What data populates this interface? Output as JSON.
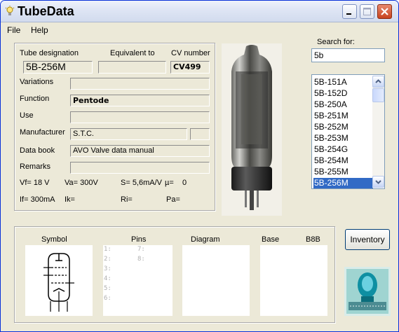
{
  "window": {
    "title": "TubeData"
  },
  "menu": {
    "file": "File",
    "help": "Help"
  },
  "fields": {
    "tube_designation_label": "Tube designation",
    "tube_designation_value": "5B-256M",
    "equivalent_label": "Equivalent to",
    "equivalent_value": "",
    "cv_label": "CV number",
    "cv_value": "CV499",
    "variations_label": "Variations",
    "variations_value": "",
    "function_label": "Function",
    "function_value": "Pentode",
    "use_label": "Use",
    "use_value": "",
    "manufacturer_label": "Manufacturer",
    "manufacturer_value": "S.T.C.",
    "manufacturer_extra": "",
    "databook_label": "Data book",
    "databook_value": "AVO Valve data manual",
    "remarks_label": "Remarks",
    "remarks_value": ""
  },
  "params": {
    "vf": "Vf= 18 V",
    "va": "Va= 300V",
    "s": "S= 5,6mA/V",
    "mu": "µ=",
    "mu_val": "0",
    "if": "If= 300mA",
    "ik": "Ik=",
    "ri": "Ri=",
    "pa": "Pa="
  },
  "search": {
    "label": "Search for:",
    "value": "5b"
  },
  "list": {
    "items": [
      "5B-151A",
      "5B-152D",
      "5B-250A",
      "5B-251M",
      "5B-252M",
      "5B-253M",
      "5B-254G",
      "5B-254M",
      "5B-255M",
      "5B-256M"
    ],
    "selected": "5B-256M"
  },
  "bottom": {
    "symbol": "Symbol",
    "pins": "Pins",
    "diagram": "Diagram",
    "base": "Base",
    "base_value": "B8B",
    "pin_numbers_left": [
      "1:",
      "2:",
      "3:",
      "4:",
      "5:",
      "6:"
    ],
    "pin_numbers_right": [
      "7:",
      "8:"
    ]
  },
  "buttons": {
    "inventory": "Inventory"
  },
  "colors": {
    "selection": "#316ac5",
    "window_bg": "#ece9d8",
    "border_blue": "#0831d9"
  },
  "icons": {
    "app": "lightbulb-icon",
    "minimize": "minimize-icon",
    "maximize": "maximize-icon",
    "close": "close-icon",
    "up": "arrow-up-icon",
    "down": "arrow-down-icon"
  }
}
